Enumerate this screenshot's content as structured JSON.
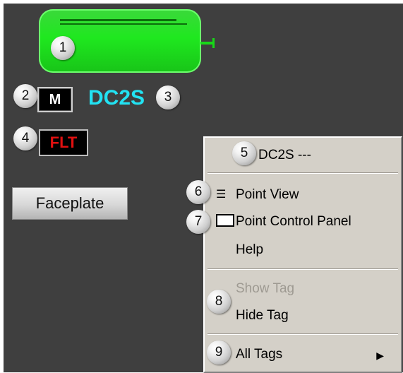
{
  "callouts": [
    "1",
    "2",
    "3",
    "4",
    "5",
    "6",
    "7",
    "8",
    "9"
  ],
  "mode_button": "M",
  "tag_name": "DC2S",
  "fault_status": "FLT",
  "faceplate_label": "Faceplate",
  "context_menu": {
    "header": "DC2S ---",
    "point_view": "Point View",
    "point_control_panel": "Point Control Panel",
    "help": "Help",
    "show_tag": "Show Tag",
    "hide_tag": "Hide Tag",
    "all_tags": "All Tags"
  },
  "colors": {
    "tank": "#1fe81f",
    "tag_name": "#22e2f2",
    "fault": "#e01010",
    "menu_bg": "#d4d0c8",
    "canvas": "#3f3f3f"
  }
}
